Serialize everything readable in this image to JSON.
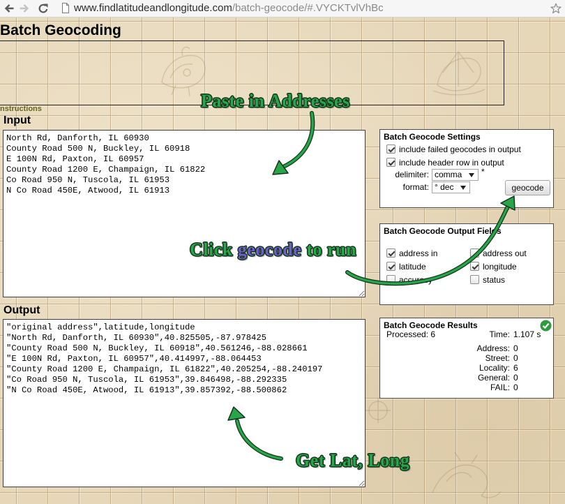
{
  "browser": {
    "url_host": "www.findlatitudeandlongitude.com",
    "url_path": "/batch-geocode/#.VYCKTvlVhBc",
    "icons": [
      "back-arrow-icon",
      "forward-arrow-icon",
      "reload-icon",
      "page-icon",
      "bookmark-star-icon"
    ]
  },
  "page": {
    "title": "Batch Geocoding",
    "instructions_link": "nstructions",
    "input_label": "Input",
    "output_label": "Output"
  },
  "input": {
    "lines": [
      "North Rd, Danforth, IL 60930",
      "County Road 500 N, Buckley, IL 60918",
      "E 100N Rd, Paxton, IL 60957",
      "County Road 1200 E, Champaign, IL 61822",
      "Co Road 950 N, Tuscola, IL 61953",
      "N Co Road 450E, Atwood, IL 61913"
    ]
  },
  "output": {
    "lines": [
      "\"original address\",latitude,longitude",
      "\"North Rd, Danforth, IL 60930\",40.825505,-87.978425",
      "\"County Road 500 N, Buckley, IL 60918\",40.561246,-88.028661",
      "\"E 100N Rd, Paxton, IL 60957\",40.414997,-88.064453",
      "\"County Road 1200 E, Champaign, IL 61822\",40.205254,-88.240197",
      "\"Co Road 950 N, Tuscola, IL 61953\",39.846498,-88.292335",
      "\"N Co Road 450E, Atwood, IL 61913\",39.857392,-88.500862"
    ]
  },
  "settings": {
    "title": "Batch Geocode Settings",
    "include_failed": {
      "label": "include failed geocodes in output",
      "checked": true
    },
    "include_header": {
      "label": "include header row in output",
      "checked": true
    },
    "delimiter": {
      "label": "delimiter:",
      "value": "comma"
    },
    "required_mark": "*",
    "format": {
      "label": "format:",
      "value": "° dec"
    },
    "geocode_button": "geocode"
  },
  "output_fields": {
    "title": "Batch Geocode Output Fields",
    "fields": [
      {
        "label": "address in",
        "checked": true
      },
      {
        "label": "address out",
        "checked": false
      },
      {
        "label": "latitude",
        "checked": true
      },
      {
        "label": "longitude",
        "checked": true
      },
      {
        "label": "accuracy",
        "checked": false
      },
      {
        "label": "status",
        "checked": false
      }
    ]
  },
  "results": {
    "title": "Batch Geocode Results",
    "status_icon": "check-circle-icon",
    "processed_label": "Processed:",
    "processed_value": "6",
    "time_label": "Time:",
    "time_value": "1.107 s",
    "counts": [
      {
        "label": "Address:",
        "value": "0"
      },
      {
        "label": "Street:",
        "value": "0"
      },
      {
        "label": "Locality:",
        "value": "6"
      },
      {
        "label": "General:",
        "value": "0"
      },
      {
        "label": "FAIL:",
        "value": "0"
      }
    ]
  },
  "annotations": {
    "paste": "Paste in Addresses",
    "click_pre": "Click",
    "click_geocode": "geocode",
    "click_post": "to run",
    "get": "Get Lat, Long"
  },
  "colors": {
    "page_background": "#e6d7b9",
    "instructions_link": "#66661a",
    "annotation_green": "#27a548",
    "annotation_purple": "#6e5fc1",
    "annotation_outline": "#10321b",
    "success_check": "#2f9a3e"
  }
}
